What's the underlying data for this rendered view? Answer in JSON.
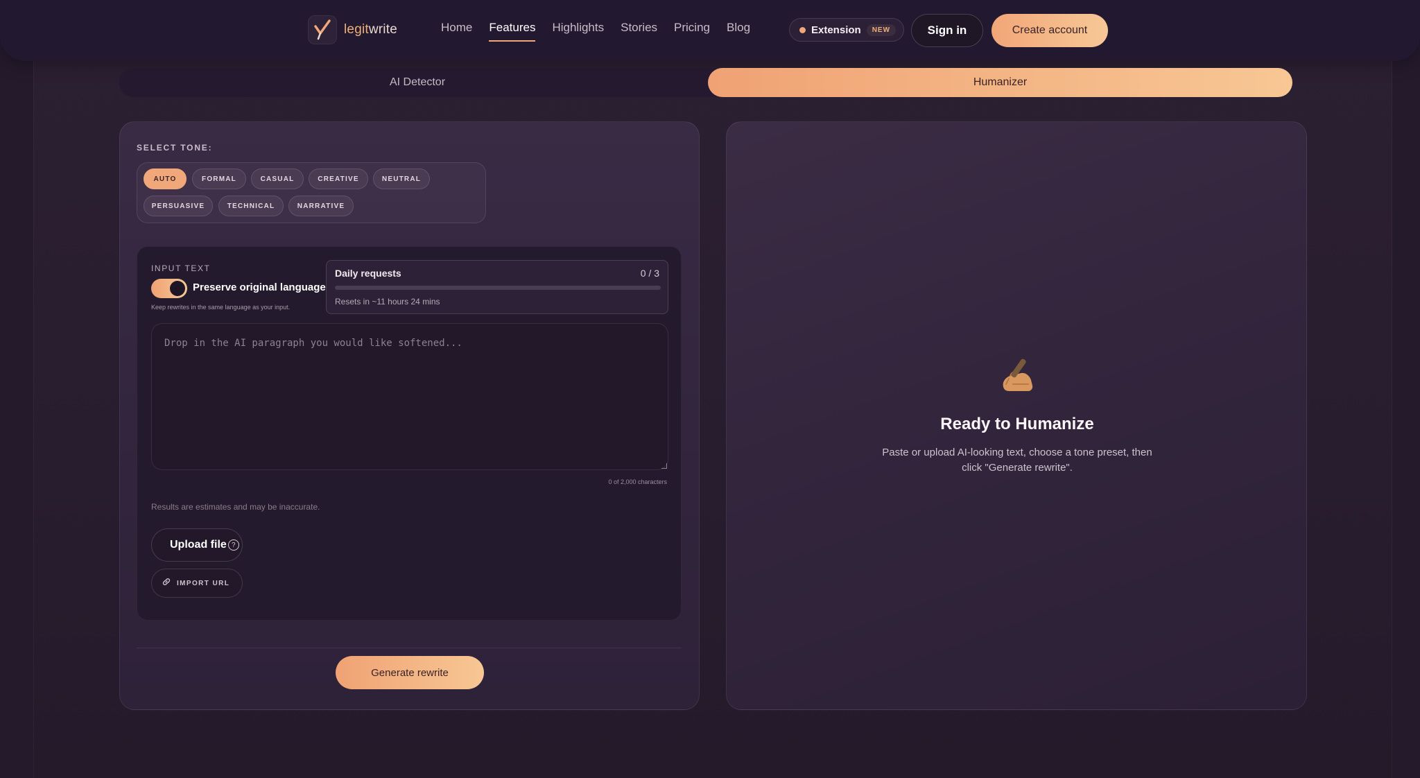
{
  "header": {
    "logo_prefix": "legit",
    "logo_suffix": "write",
    "nav": [
      {
        "label": "Home",
        "active": false
      },
      {
        "label": "Features",
        "active": true
      },
      {
        "label": "Highlights",
        "active": false
      },
      {
        "label": "Stories",
        "active": false
      },
      {
        "label": "Pricing",
        "active": false
      },
      {
        "label": "Blog",
        "active": false
      }
    ],
    "extension_label": "Extension",
    "extension_badge": "NEW",
    "signin_label": "Sign in",
    "create_label": "Create account"
  },
  "mode_tabs": {
    "detector": "AI Detector",
    "humanizer": "Humanizer",
    "active": "humanizer"
  },
  "tone": {
    "title": "SELECT TONE:",
    "options": [
      "AUTO",
      "FORMAL",
      "CASUAL",
      "CREATIVE",
      "NEUTRAL",
      "PERSUASIVE",
      "TECHNICAL",
      "NARRATIVE"
    ],
    "selected": "AUTO"
  },
  "input": {
    "title": "INPUT TEXT",
    "toggle_label": "Preserve original language",
    "toggle_on": true,
    "toggle_help": "Keep rewrites in the same language as your input.",
    "placeholder": "Drop in the AI paragraph you would like softened...",
    "char_count": "0 of 2,000 characters",
    "disclaimer": "Results are estimates and may be inaccurate.",
    "upload_label": "Upload file",
    "help_glyph": "?",
    "import_label": "IMPORT URL"
  },
  "daily": {
    "title": "Daily requests",
    "count": "0 / 3",
    "used_fraction": 0,
    "reset": "Resets in ~11 hours 24 mins"
  },
  "generate_label": "Generate rewrite",
  "empty_state": {
    "icon": "writing-hand-icon",
    "title": "Ready to Humanize",
    "text": "Paste or upload AI-looking text, choose a tone preset, then click \"Generate rewrite\"."
  },
  "colors": {
    "accent": "#f0a77a",
    "accent_light": "#f7c794",
    "background": "#241a2c"
  }
}
